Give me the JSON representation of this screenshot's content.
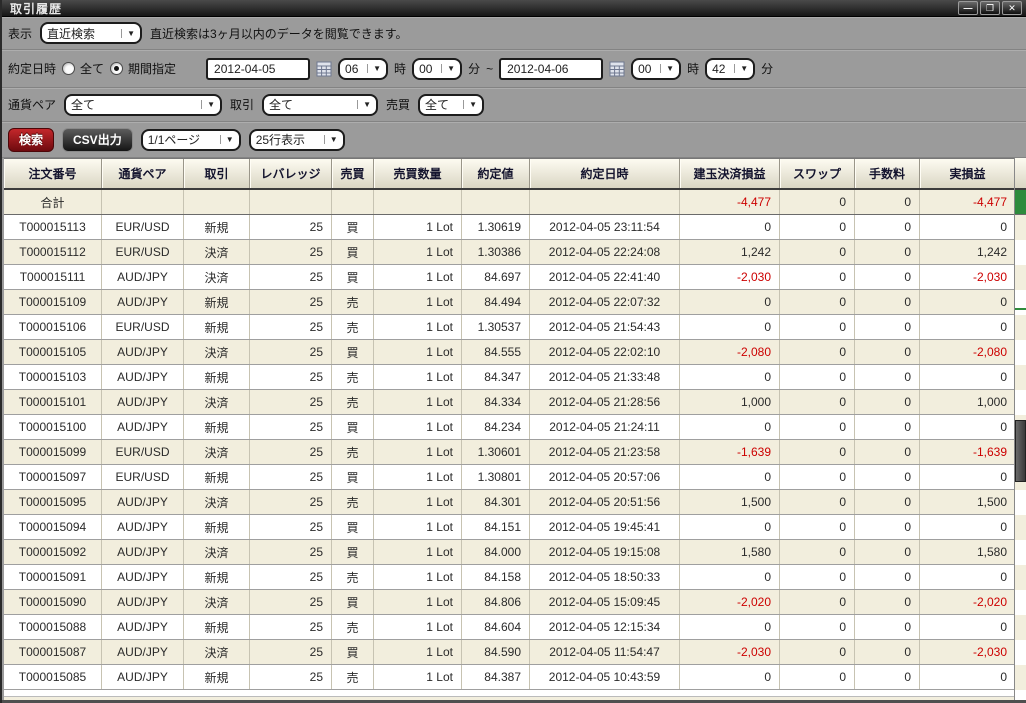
{
  "window": {
    "title": "取引履歴",
    "controls": {
      "minimize": "—",
      "maximize": "❐",
      "close": "✕"
    }
  },
  "filters": {
    "display": {
      "label": "表示",
      "value": "直近検索",
      "note": "直近検索は3ヶ月以内のデータを閲覧できます。"
    },
    "datetime": {
      "label": "約定日時",
      "radio_all": "全て",
      "radio_period": "期間指定",
      "from_date": "2012-04-05",
      "from_hour": "06",
      "from_minute": "00",
      "to_date": "2012-04-06",
      "to_hour": "00",
      "to_minute": "42",
      "hour_unit": "時",
      "minute_unit": "分",
      "range_separator": "~"
    },
    "pair": {
      "label": "通貨ペア",
      "value": "全て"
    },
    "trade": {
      "label": "取引",
      "value": "全て"
    },
    "side": {
      "label": "売買",
      "value": "全て"
    }
  },
  "toolbar": {
    "search_label": "検索",
    "csv_label": "CSV出力",
    "page_value": "1/1ページ",
    "rows_value": "25行表示"
  },
  "table": {
    "headers": [
      "注文番号",
      "通貨ペア",
      "取引",
      "レバレッジ",
      "売買",
      "売買数量",
      "約定値",
      "約定日時",
      "建玉決済損益",
      "スワップ",
      "手数料",
      "実損益"
    ],
    "total": {
      "label": "合計",
      "pl": "-4,477",
      "swap": "0",
      "fee": "0",
      "net": "-4,477"
    },
    "rows": [
      [
        "T000015113",
        "EUR/USD",
        "新規",
        "25",
        "買",
        "1 Lot",
        "1.30619",
        "2012-04-05 23:11:54",
        "0",
        "0",
        "0",
        "0"
      ],
      [
        "T000015112",
        "EUR/USD",
        "決済",
        "25",
        "買",
        "1 Lot",
        "1.30386",
        "2012-04-05 22:24:08",
        "1,242",
        "0",
        "0",
        "1,242"
      ],
      [
        "T000015111",
        "AUD/JPY",
        "決済",
        "25",
        "買",
        "1 Lot",
        "84.697",
        "2012-04-05 22:41:40",
        "-2,030",
        "0",
        "0",
        "-2,030"
      ],
      [
        "T000015109",
        "AUD/JPY",
        "新規",
        "25",
        "売",
        "1 Lot",
        "84.494",
        "2012-04-05 22:07:32",
        "0",
        "0",
        "0",
        "0"
      ],
      [
        "T000015106",
        "EUR/USD",
        "新規",
        "25",
        "売",
        "1 Lot",
        "1.30537",
        "2012-04-05 21:54:43",
        "0",
        "0",
        "0",
        "0"
      ],
      [
        "T000015105",
        "AUD/JPY",
        "決済",
        "25",
        "買",
        "1 Lot",
        "84.555",
        "2012-04-05 22:02:10",
        "-2,080",
        "0",
        "0",
        "-2,080"
      ],
      [
        "T000015103",
        "AUD/JPY",
        "新規",
        "25",
        "売",
        "1 Lot",
        "84.347",
        "2012-04-05 21:33:48",
        "0",
        "0",
        "0",
        "0"
      ],
      [
        "T000015101",
        "AUD/JPY",
        "決済",
        "25",
        "売",
        "1 Lot",
        "84.334",
        "2012-04-05 21:28:56",
        "1,000",
        "0",
        "0",
        "1,000"
      ],
      [
        "T000015100",
        "AUD/JPY",
        "新規",
        "25",
        "買",
        "1 Lot",
        "84.234",
        "2012-04-05 21:24:11",
        "0",
        "0",
        "0",
        "0"
      ],
      [
        "T000015099",
        "EUR/USD",
        "決済",
        "25",
        "売",
        "1 Lot",
        "1.30601",
        "2012-04-05 21:23:58",
        "-1,639",
        "0",
        "0",
        "-1,639"
      ],
      [
        "T000015097",
        "EUR/USD",
        "新規",
        "25",
        "買",
        "1 Lot",
        "1.30801",
        "2012-04-05 20:57:06",
        "0",
        "0",
        "0",
        "0"
      ],
      [
        "T000015095",
        "AUD/JPY",
        "決済",
        "25",
        "売",
        "1 Lot",
        "84.301",
        "2012-04-05 20:51:56",
        "1,500",
        "0",
        "0",
        "1,500"
      ],
      [
        "T000015094",
        "AUD/JPY",
        "新規",
        "25",
        "買",
        "1 Lot",
        "84.151",
        "2012-04-05 19:45:41",
        "0",
        "0",
        "0",
        "0"
      ],
      [
        "T000015092",
        "AUD/JPY",
        "決済",
        "25",
        "買",
        "1 Lot",
        "84.000",
        "2012-04-05 19:15:08",
        "1,580",
        "0",
        "0",
        "1,580"
      ],
      [
        "T000015091",
        "AUD/JPY",
        "新規",
        "25",
        "売",
        "1 Lot",
        "84.158",
        "2012-04-05 18:50:33",
        "0",
        "0",
        "0",
        "0"
      ],
      [
        "T000015090",
        "AUD/JPY",
        "決済",
        "25",
        "買",
        "1 Lot",
        "84.806",
        "2012-04-05 15:09:45",
        "-2,020",
        "0",
        "0",
        "-2,020"
      ],
      [
        "T000015088",
        "AUD/JPY",
        "新規",
        "25",
        "売",
        "1 Lot",
        "84.604",
        "2012-04-05 12:15:34",
        "0",
        "0",
        "0",
        "0"
      ],
      [
        "T000015087",
        "AUD/JPY",
        "決済",
        "25",
        "買",
        "1 Lot",
        "84.590",
        "2012-04-05 11:54:47",
        "-2,030",
        "0",
        "0",
        "-2,030"
      ],
      [
        "T000015085",
        "AUD/JPY",
        "新規",
        "25",
        "売",
        "1 Lot",
        "84.387",
        "2012-04-05 10:43:59",
        "0",
        "0",
        "0",
        "0"
      ]
    ]
  },
  "colors": {
    "negative_value": "#cc0000",
    "search_button": "#a01318",
    "row_stripe": "#f2eedd",
    "header_gradient_top": "#fdfbf1",
    "header_gradient_bottom": "#dad6c4",
    "sliver_green": "#2e8b3d",
    "panel_gray": "#9b9b9b"
  }
}
